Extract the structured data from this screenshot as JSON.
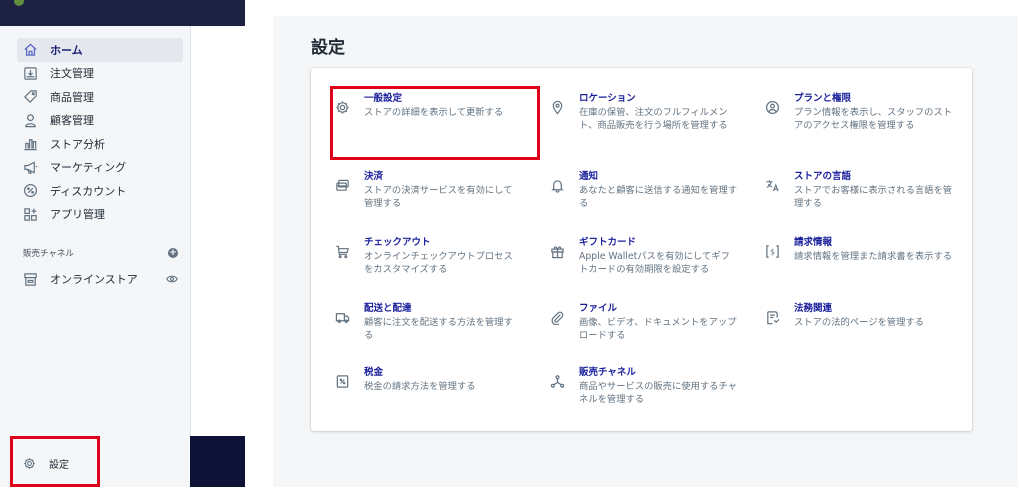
{
  "sidebar": {
    "nav": [
      {
        "icon": "home-icon",
        "label": "ホーム",
        "active": true
      },
      {
        "icon": "orders-icon",
        "label": "注文管理"
      },
      {
        "icon": "tag-icon",
        "label": "商品管理"
      },
      {
        "icon": "person-icon",
        "label": "顧客管理"
      },
      {
        "icon": "analytics-icon",
        "label": "ストア分析"
      },
      {
        "icon": "megaphone-icon",
        "label": "マーケティング"
      },
      {
        "icon": "discount-icon",
        "label": "ディスカウント"
      },
      {
        "icon": "apps-icon",
        "label": "アプリ管理"
      }
    ],
    "channels_header": "販売チャネル",
    "online_store": "オンラインストア",
    "settings_label": "設定"
  },
  "main": {
    "title": "設定",
    "items": [
      {
        "icon": "gear-icon",
        "title": "一般設定",
        "desc": "ストアの詳細を表示して更新する"
      },
      {
        "icon": "location-pin-icon",
        "title": "ロケーション",
        "desc": "在庫の保管、注文のフルフィルメント、商品販売を行う場所を管理する"
      },
      {
        "icon": "plan-icon",
        "title": "プランと権限",
        "desc": "プラン情報を表示し、スタッフのストアのアクセス権限を管理する"
      },
      {
        "icon": "payments-icon",
        "title": "決済",
        "desc": "ストアの決済サービスを有効にして管理する"
      },
      {
        "icon": "bell-icon",
        "title": "通知",
        "desc": "あなたと顧客に送信する通知を管理する"
      },
      {
        "icon": "language-icon",
        "title": "ストアの言語",
        "desc": "ストアでお客様に表示される言語を管理する"
      },
      {
        "icon": "cart-icon",
        "title": "チェックアウト",
        "desc": "オンラインチェックアウトプロセスをカスタマイズする"
      },
      {
        "icon": "gift-icon",
        "title": "ギフトカード",
        "desc": "Apple Walletパスを有効にしてギフトカードの有効期限を設定する"
      },
      {
        "icon": "billing-icon",
        "title": "請求情報",
        "desc": "請求情報を管理また請求書を表示する"
      },
      {
        "icon": "truck-icon",
        "title": "配送と配達",
        "desc": "顧客に注文を配送する方法を管理する"
      },
      {
        "icon": "paperclip-icon",
        "title": "ファイル",
        "desc": "画像、ビデオ、ドキュメントをアップロードする"
      },
      {
        "icon": "legal-icon",
        "title": "法務関連",
        "desc": "ストアの法的ページを管理する"
      },
      {
        "icon": "tax-icon",
        "title": "税金",
        "desc": "税金の請求方法を管理する"
      },
      {
        "icon": "channels-icon",
        "title": "販売チャネル",
        "desc": "商品やサービスの販売に使用するチャネルを管理する"
      }
    ]
  },
  "colors": {
    "accent": "#1a1f9c",
    "highlight": "#e0001a",
    "topbar": "#1e2242"
  }
}
